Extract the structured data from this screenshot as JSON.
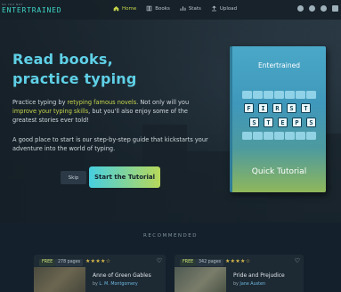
{
  "brand": {
    "tagline": "SO YOU NOT",
    "name": "ENTERTRAINED"
  },
  "nav": [
    {
      "label": "Home",
      "icon": "home-icon",
      "active": true
    },
    {
      "label": "Books",
      "icon": "book-icon",
      "active": false
    },
    {
      "label": "Stats",
      "icon": "stats-icon",
      "active": false
    },
    {
      "label": "Upload",
      "icon": "upload-icon",
      "active": false
    }
  ],
  "top_icons": [
    "discord-icon",
    "github-icon",
    "info-icon",
    "account-icon"
  ],
  "hero": {
    "headline_1": "Read books,",
    "headline_2": "practice typing",
    "desc_a": "Practice typing by ",
    "desc_hl1": "retyping famous novels",
    "desc_b": ". Not only will you ",
    "desc_hl2": "improve your typing skills",
    "desc_c": ", but you'll also enjoy some of the greatest stories ever told!",
    "desc2": "A good place to start is our step-by-step guide that kickstarts your adventure into the world of typing.",
    "skip_label": "Skip",
    "tutorial_label": "Start the Tutorial"
  },
  "tutorial_book": {
    "title": "Entertrained",
    "keys_row1": [
      "F",
      "I",
      "R",
      "S",
      "T"
    ],
    "keys_row2": [
      "S",
      "T",
      "E",
      "P",
      "S"
    ],
    "subtitle": "Quick Tutorial"
  },
  "recommended": {
    "title": "RECOMMENDED",
    "cards": [
      {
        "badge": "FREE",
        "pages": "278 pages",
        "stars": "★★★★☆",
        "title": "Anne of Green Gables",
        "author_prefix": "by ",
        "author": "L. M. Montgomery"
      },
      {
        "badge": "FREE",
        "pages": "342 pages",
        "stars": "★★★★☆",
        "title": "Pride and Prejudice",
        "author_prefix": "by ",
        "author": "Jane Austen"
      }
    ]
  },
  "colors": {
    "accent": "#5fd0e6",
    "highlight": "#c7d64a",
    "background": "#14202b"
  }
}
